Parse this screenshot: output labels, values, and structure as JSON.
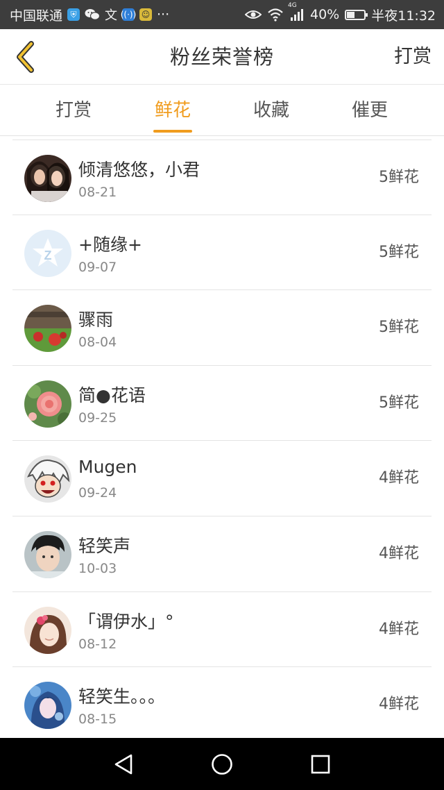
{
  "status_bar": {
    "carrier": "中国联通",
    "network": "4G",
    "battery": "40%",
    "time": "半夜11:32",
    "battery_level": 0.4
  },
  "header": {
    "title": "粉丝荣誉榜",
    "right_action": "打赏"
  },
  "tabs": [
    {
      "label": "打赏",
      "active": false
    },
    {
      "label": "鲜花",
      "active": true
    },
    {
      "label": "收藏",
      "active": false
    },
    {
      "label": "催更",
      "active": false
    }
  ],
  "accent_color": "#f09c1e",
  "entries": [
    {
      "name": "倾清悠悠，小君",
      "date": "08-21",
      "count": "5鲜花",
      "avatar": "avatar-two-girls"
    },
    {
      "name": "+随缘+",
      "date": "09-07",
      "count": "5鲜花",
      "avatar": "avatar-default-qq"
    },
    {
      "name": "骤雨",
      "date": "08-04",
      "count": "5鲜花",
      "avatar": "avatar-field"
    },
    {
      "name": "简●花语",
      "date": "09-25",
      "count": "5鲜花",
      "avatar": "avatar-rose"
    },
    {
      "name": "Mugen",
      "date": "09-24",
      "count": "4鲜花",
      "avatar": "avatar-anime-boy"
    },
    {
      "name": "轻笑声",
      "date": "10-03",
      "count": "4鲜花",
      "avatar": "avatar-young-man"
    },
    {
      "name": "「谓伊水」°",
      "date": "08-12",
      "count": "4鲜花",
      "avatar": "avatar-anime-girl"
    },
    {
      "name": "轻笑生。。。",
      "date": "08-15",
      "count": "4鲜花",
      "avatar": "avatar-fantasy-girl"
    }
  ]
}
